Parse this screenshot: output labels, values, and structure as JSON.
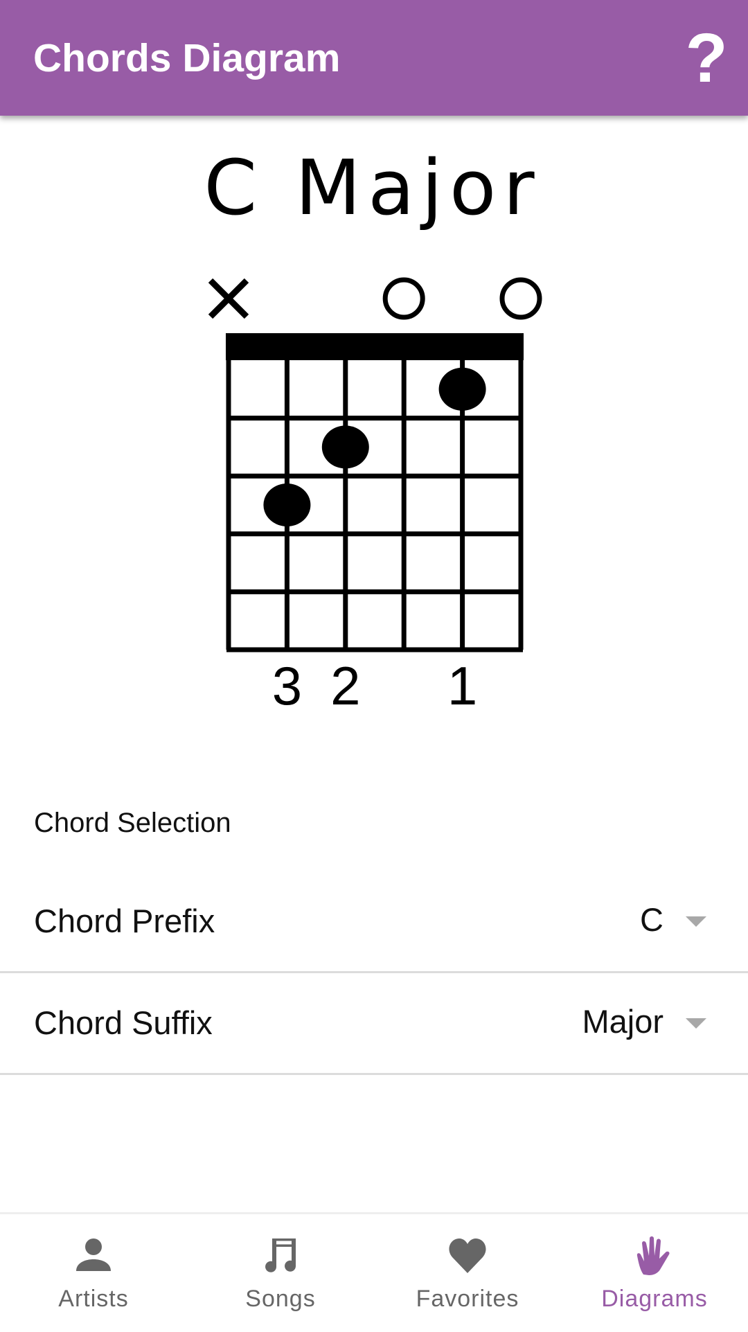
{
  "appbar": {
    "title": "Chords Diagram",
    "help_label": "?",
    "color": "#985ca6"
  },
  "chord": {
    "name": "C Major",
    "strings": 6,
    "frets_shown": 5,
    "string_markers": [
      "x",
      "",
      "",
      "o",
      "",
      "o"
    ],
    "dots": [
      {
        "string": 5,
        "fret": 1
      },
      {
        "string": 3,
        "fret": 2
      },
      {
        "string": 2,
        "fret": 3
      }
    ],
    "fingers": [
      "",
      "3",
      "2",
      "",
      "1",
      ""
    ]
  },
  "selection": {
    "section_label": "Chord Selection",
    "prefix": {
      "label": "Chord Prefix",
      "value": "C"
    },
    "suffix": {
      "label": "Chord Suffix",
      "value": "Major"
    }
  },
  "nav": {
    "active_color": "#985ca6",
    "inactive_color": "#666666",
    "items": [
      {
        "label": "Artists",
        "icon": "person-icon",
        "active": false
      },
      {
        "label": "Songs",
        "icon": "music-note-icon",
        "active": false
      },
      {
        "label": "Favorites",
        "icon": "heart-icon",
        "active": false
      },
      {
        "label": "Diagrams",
        "icon": "hand-icon",
        "active": true
      }
    ]
  }
}
